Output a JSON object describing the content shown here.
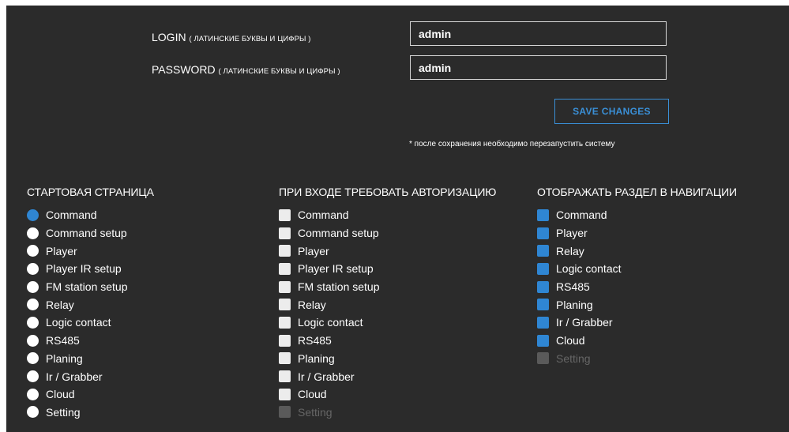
{
  "credentials": {
    "login_label": "LOGIN",
    "login_hint": "( ЛАТИНСКИЕ БУКВЫ И ЦИФРЫ )",
    "login_value": "admin",
    "password_label": "PASSWORD",
    "password_hint": "( ЛАТИНСКИЕ БУКВЫ И ЦИФРЫ )",
    "password_value": "admin",
    "save_label": "SAVE CHANGES",
    "note": "* после сохранения необходимо перезапустить систему"
  },
  "colors": {
    "panel_bg": "#2b2b2b",
    "accent": "#2f86d3",
    "button_text": "#3a8fd6"
  },
  "start_page": {
    "title": "СТАРТОВАЯ СТРАНИЦА",
    "items": [
      {
        "label": "Command",
        "selected": true
      },
      {
        "label": "Command setup",
        "selected": false
      },
      {
        "label": "Player",
        "selected": false
      },
      {
        "label": "Player IR setup",
        "selected": false
      },
      {
        "label": "FM station setup",
        "selected": false
      },
      {
        "label": "Relay",
        "selected": false
      },
      {
        "label": "Logic contact",
        "selected": false
      },
      {
        "label": "RS485",
        "selected": false
      },
      {
        "label": "Planing",
        "selected": false
      },
      {
        "label": "Ir / Grabber",
        "selected": false
      },
      {
        "label": "Cloud",
        "selected": false
      },
      {
        "label": "Setting",
        "selected": false
      }
    ]
  },
  "auth_required": {
    "title": "ПРИ ВХОДЕ ТРЕБОВАТЬ АВТОРИЗАЦИЮ",
    "items": [
      {
        "label": "Command",
        "checked": false,
        "disabled": false
      },
      {
        "label": "Command setup",
        "checked": false,
        "disabled": false
      },
      {
        "label": "Player",
        "checked": false,
        "disabled": false
      },
      {
        "label": "Player IR setup",
        "checked": false,
        "disabled": false
      },
      {
        "label": "FM station setup",
        "checked": false,
        "disabled": false
      },
      {
        "label": "Relay",
        "checked": false,
        "disabled": false
      },
      {
        "label": "Logic contact",
        "checked": false,
        "disabled": false
      },
      {
        "label": "RS485",
        "checked": false,
        "disabled": false
      },
      {
        "label": "Planing",
        "checked": false,
        "disabled": false
      },
      {
        "label": "Ir / Grabber",
        "checked": false,
        "disabled": false
      },
      {
        "label": "Cloud",
        "checked": false,
        "disabled": false
      },
      {
        "label": "Setting",
        "checked": false,
        "disabled": true
      }
    ]
  },
  "nav_display": {
    "title": "ОТОБРАЖАТЬ РАЗДЕЛ В НАВИГАЦИИ",
    "items": [
      {
        "label": "Command",
        "checked": true,
        "disabled": false
      },
      {
        "label": "Player",
        "checked": true,
        "disabled": false
      },
      {
        "label": "Relay",
        "checked": true,
        "disabled": false
      },
      {
        "label": "Logic contact",
        "checked": true,
        "disabled": false
      },
      {
        "label": "RS485",
        "checked": true,
        "disabled": false
      },
      {
        "label": "Planing",
        "checked": true,
        "disabled": false
      },
      {
        "label": "Ir / Grabber",
        "checked": true,
        "disabled": false
      },
      {
        "label": "Cloud",
        "checked": true,
        "disabled": false
      },
      {
        "label": "Setting",
        "checked": false,
        "disabled": true
      }
    ]
  }
}
